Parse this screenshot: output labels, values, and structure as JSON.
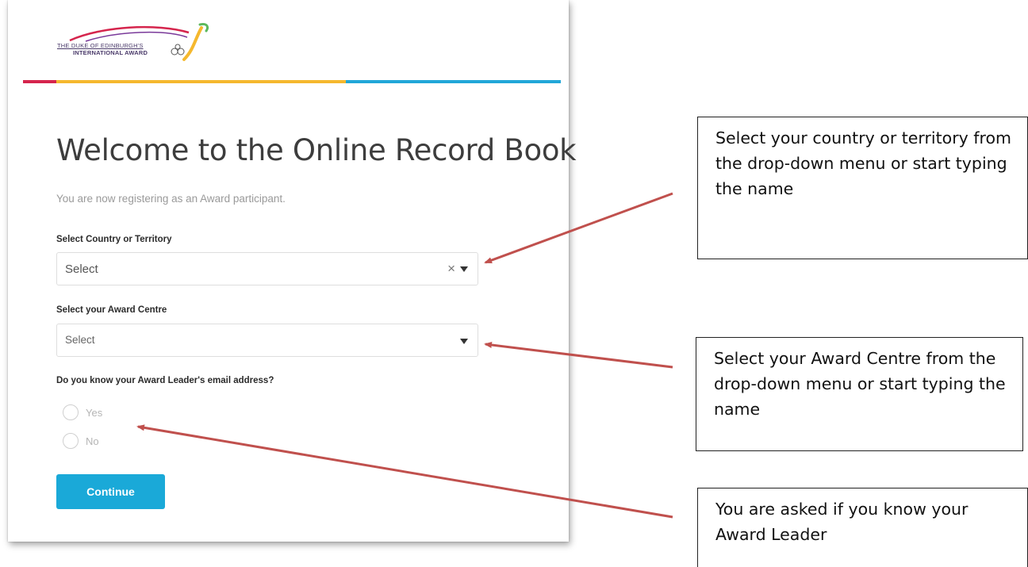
{
  "logo": {
    "line1": "THE DUKE OF EDINBURGH'S",
    "line2": "INTERNATIONAL AWARD"
  },
  "page": {
    "title": "Welcome to the Online Record Book",
    "subtitle": "You are now registering as an Award participant."
  },
  "form": {
    "country_label": "Select Country or Territory",
    "country_value": "Select",
    "country_clear": "×",
    "centre_label": "Select your Award Centre",
    "centre_value": "Select",
    "leader_question": "Do you know your Award Leader's email address?",
    "options": [
      "Yes",
      "No"
    ],
    "continue_label": "Continue"
  },
  "callouts": [
    "Select your country or territory from the drop-down menu or start typing the name",
    "Select your Award Centre from the drop-down menu or start typing the name",
    "You are asked if you know your Award Leader"
  ],
  "colors": {
    "accent": "#1aa9d8",
    "stripe_red": "#d5254d",
    "stripe_yellow": "#f5b82e",
    "stripe_blue": "#22a7d8",
    "arrow": "#c0504d"
  }
}
